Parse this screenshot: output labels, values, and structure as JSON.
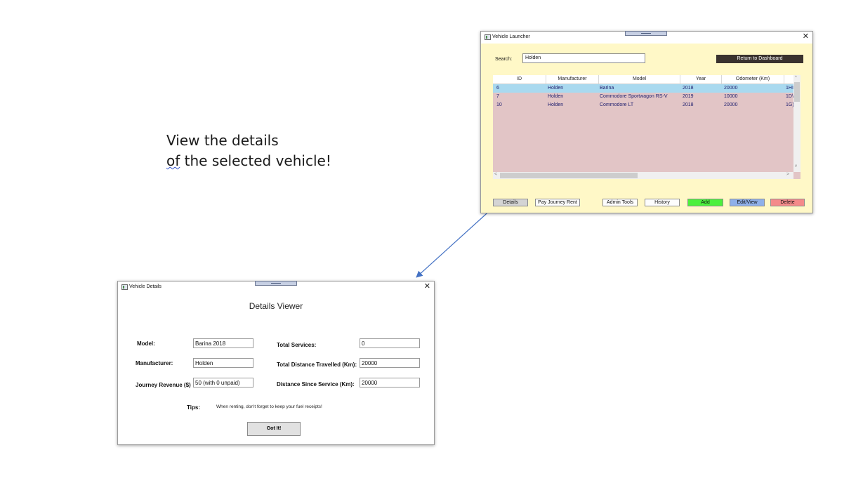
{
  "caption": {
    "line1": "View the details",
    "line2_word": "of",
    "line2_rest": " the selected vehicle!"
  },
  "launcher": {
    "title": "Vehicle Launcher",
    "search_label": "Search:",
    "search_value": "Holden",
    "return_button": "Return to Dashboard",
    "columns": [
      "ID",
      "Manufacturer",
      "Model",
      "Year",
      "Odometer (Km)"
    ],
    "rows": [
      {
        "id": "6",
        "manufacturer": "Holden",
        "model": "Barina",
        "year": "2018",
        "odometer": "20000",
        "extra": "1HI"
      },
      {
        "id": "7",
        "manufacturer": "Holden",
        "model": "Commodore Sportwagon RS-V",
        "year": "2019",
        "odometer": "10000",
        "extra": "1D\\"
      },
      {
        "id": "10",
        "manufacturer": "Holden",
        "model": "Commodore LT",
        "year": "2018",
        "odometer": "20000",
        "extra": "1G)"
      }
    ],
    "buttons": {
      "details": "Details",
      "pay": "Pay Journey Rent",
      "admin": "Admin Tools",
      "history": "History",
      "add": "Add",
      "edit": "Edit/View",
      "delete": "Delete"
    },
    "colors": {
      "add": "#4cf03c",
      "edit": "#8fb0ea",
      "delete": "#f48a8a",
      "return": "#3a322e",
      "body": "#fff8c7"
    }
  },
  "details": {
    "title": "Vehicle Details",
    "heading": "Details Viewer",
    "model_label": "Model:",
    "model_value": "Barina 2018",
    "manufacturer_label": "Manufacturer:",
    "manufacturer_value": "Holden",
    "revenue_label": "Journey Revenue ($)",
    "revenue_value": "50 (with 0 unpaid)",
    "services_label": "Total Services:",
    "services_value": "0",
    "distance_label": "Total Distance Travelled (Km):",
    "distance_value": "20000",
    "since_label": "Distance Since Service (Km):",
    "since_value": "20000",
    "tips_label": "Tips:",
    "tips_text": "When renting, don't forget to keep your fuel receipts!",
    "got_it": "Got It!"
  }
}
